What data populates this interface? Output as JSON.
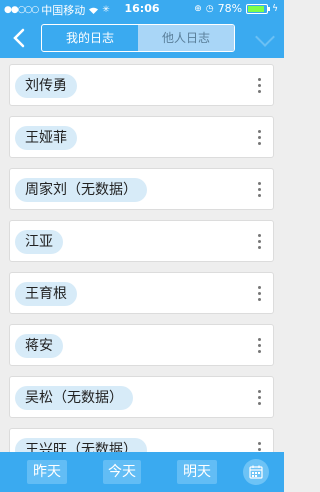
{
  "status": {
    "carrier": "中国移动",
    "time": "16:06",
    "battery": "78%",
    "battery_level": 0.78
  },
  "nav": {
    "back_icon": "chevron-left-icon",
    "tabs": [
      {
        "label": "我的日志",
        "active": false
      },
      {
        "label": "他人日志",
        "active": true
      }
    ]
  },
  "people": [
    {
      "name": "刘传勇"
    },
    {
      "name": "王娅菲"
    },
    {
      "name": "周家刘（无数据）"
    },
    {
      "name": "江亚"
    },
    {
      "name": "王育根"
    },
    {
      "name": "蒋安"
    },
    {
      "name": "吴松（无数据）"
    },
    {
      "name": "王兴旺（无数据）"
    }
  ],
  "bottom": {
    "yesterday": "昨天",
    "today": "今天",
    "tomorrow": "明天",
    "calendar_icon": "calendar-icon"
  },
  "colors": {
    "primary": "#3aaaf0",
    "pill": "#d7ebf8"
  }
}
